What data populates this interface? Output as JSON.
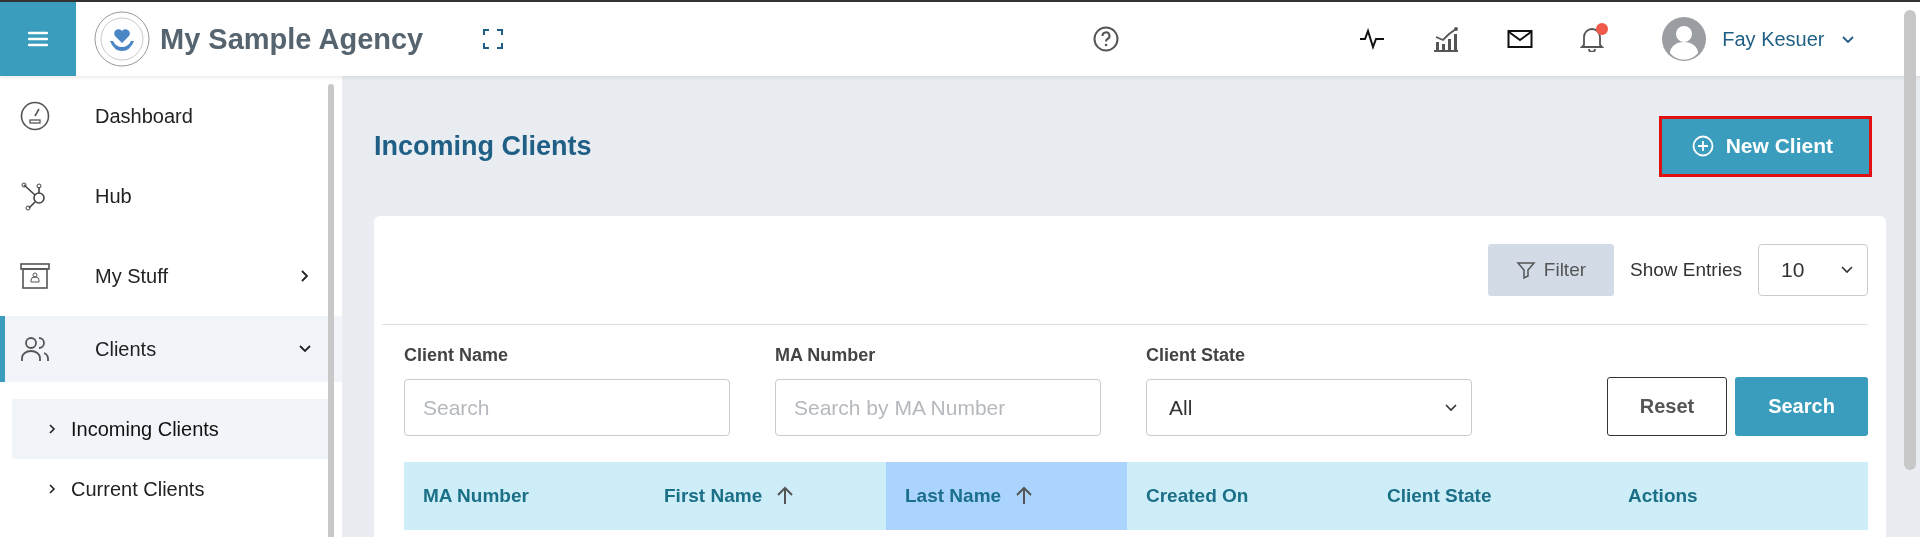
{
  "brand": {
    "name": "My Sample Agency"
  },
  "user": {
    "name": "Fay Kesuer",
    "notification_unread": true
  },
  "sidebar": {
    "items": [
      {
        "label": "Dashboard",
        "selected": false
      },
      {
        "label": "Hub",
        "selected": false
      },
      {
        "label": "My Stuff",
        "selected": false,
        "expanded": false
      },
      {
        "label": "Clients",
        "selected": true,
        "expanded": true,
        "children": [
          {
            "label": "Incoming Clients",
            "selected": true
          },
          {
            "label": "Current Clients",
            "selected": false
          }
        ]
      }
    ]
  },
  "page": {
    "title": "Incoming Clients",
    "new_button": "New Client"
  },
  "toolbar": {
    "filter": "Filter",
    "show_entries_label": "Show Entries",
    "show_entries_value": "10"
  },
  "filters": [
    {
      "kind": "text",
      "label": "Client Name",
      "placeholder": "Search"
    },
    {
      "kind": "text",
      "label": "MA Number",
      "placeholder": "Search by MA Number"
    },
    {
      "kind": "select",
      "label": "Client State",
      "value": "All"
    }
  ],
  "buttons": {
    "reset": "Reset",
    "search": "Search"
  },
  "table": {
    "columns": [
      {
        "label": "MA Number",
        "sortable": false,
        "selected": false
      },
      {
        "label": "First Name",
        "sortable": true,
        "selected": false
      },
      {
        "label": "Last Name",
        "sortable": true,
        "selected": true
      },
      {
        "label": "Created On",
        "sortable": false,
        "selected": false
      },
      {
        "label": "Client State",
        "sortable": false,
        "selected": false
      },
      {
        "label": "Actions",
        "sortable": false,
        "selected": false
      }
    ]
  }
}
